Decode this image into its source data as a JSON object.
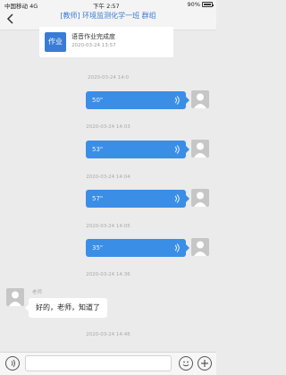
{
  "status_bar": {
    "carrier": "中国移动 4G",
    "time": "下午 2:57",
    "battery": "90%"
  },
  "nav": {
    "title": "[教师] 环境监测化学一班 群组"
  },
  "card": {
    "icon_label": "作业",
    "title": "语音作业完成度",
    "subtitle": "2020-03-24 13:57"
  },
  "messages": [
    {
      "time": "2020-03-24 14:0",
      "type": "voice",
      "duration": "50\""
    },
    {
      "time": "2020-03-24 14:03",
      "type": "voice",
      "duration": "53\""
    },
    {
      "time": "2020-03-24 14:04",
      "type": "voice",
      "duration": "57\""
    },
    {
      "time": "2020-03-24 14:05",
      "type": "voice",
      "duration": "35\""
    },
    {
      "time": "2020-03-24 14:36",
      "type": "text",
      "sender": "老师",
      "text": "好的，老师，知道了"
    },
    {
      "time": "2020-03-24 14:46"
    }
  ],
  "icons": {
    "back": "back-chevron-icon",
    "voice_toggle": "voice-mode-icon",
    "emoji": "emoji-icon",
    "more": "plus-icon"
  },
  "colors": {
    "accent": "#3a8ee6",
    "title_blue": "#3a7bd5"
  }
}
